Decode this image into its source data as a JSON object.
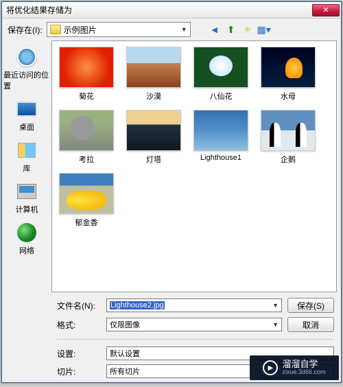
{
  "window": {
    "title": "将优化结果存储为"
  },
  "toprow": {
    "label": "保存在(I):",
    "folder": "示例图片",
    "nav": {
      "back": "←",
      "up": "↑",
      "newfolder": "📁",
      "view": "▦"
    }
  },
  "places": [
    {
      "label": "最近访问的位置",
      "ico": "ico-recent"
    },
    {
      "label": "桌面",
      "ico": "ico-desktop"
    },
    {
      "label": "库",
      "ico": "ico-lib"
    },
    {
      "label": "计算机",
      "ico": "ico-comp"
    },
    {
      "label": "网络",
      "ico": "ico-net"
    }
  ],
  "files": [
    {
      "label": "菊花",
      "cls": "t0"
    },
    {
      "label": "沙漠",
      "cls": "t1"
    },
    {
      "label": "八仙花",
      "cls": "t2"
    },
    {
      "label": "水母",
      "cls": "t3"
    },
    {
      "label": "考拉",
      "cls": "t4"
    },
    {
      "label": "灯塔",
      "cls": "t5"
    },
    {
      "label": "Lighthouse1",
      "cls": "t6"
    },
    {
      "label": "企鹅",
      "cls": "t7"
    },
    {
      "label": "郁金香",
      "cls": "t8"
    }
  ],
  "fields": {
    "filename_label": "文件名(N):",
    "filename_value": "Lighthouse2.jpg",
    "format_label": "格式:",
    "format_value": "仅限图像",
    "settings_label": "设置:",
    "settings_value": "默认设置",
    "slice_label": "切片:",
    "slice_value": "所有切片"
  },
  "buttons": {
    "save": "保存(S)",
    "cancel": "取消"
  },
  "watermark": {
    "name": "溜溜自学",
    "url": "zixue.3d66.com"
  }
}
